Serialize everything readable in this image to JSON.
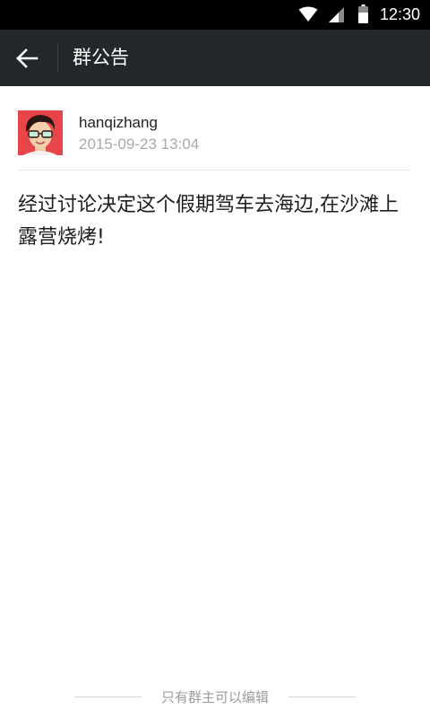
{
  "status_bar": {
    "time": "12:30",
    "icons": [
      "wifi-icon",
      "cell-signal-icon",
      "battery-icon"
    ]
  },
  "toolbar": {
    "back_icon": "arrow-left-icon",
    "title": "群公告"
  },
  "announcement": {
    "author": "hanqizhang",
    "timestamp": "2015-09-23 13:04",
    "content": "经过讨论决定这个假期驾车去海边,在沙滩上露营烧烤!"
  },
  "footer": {
    "note": "只有群主可以编辑"
  },
  "colors": {
    "status_bar": "#000000",
    "toolbar": "#22282a",
    "background": "#ffffff",
    "timestamp": "#a9a9a9",
    "footer_text": "#9b9b9b"
  }
}
